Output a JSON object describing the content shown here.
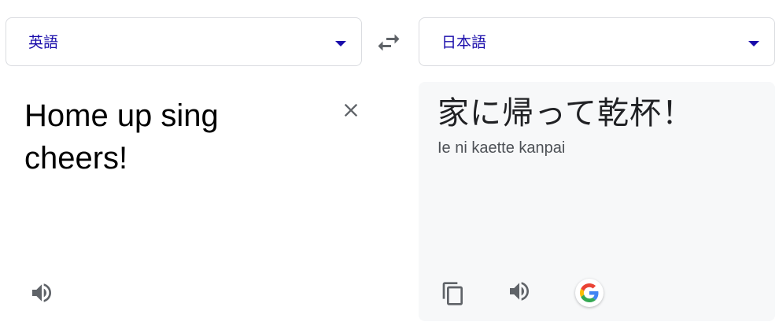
{
  "source_language": {
    "label": "英語"
  },
  "target_language": {
    "label": "日本語"
  },
  "source": {
    "text": "Home up sing cheers!"
  },
  "target": {
    "text": "家に帰って乾杯！",
    "romanization": "Ie ni kaette kanpai"
  },
  "icons": {
    "swap": "swap-arrows-icon",
    "clear": "close-icon",
    "source_speaker": "speaker-icon",
    "copy": "copy-icon",
    "target_speaker": "speaker-icon",
    "google": "google-g-logo-icon"
  },
  "colors": {
    "language_link": "#1a0dab",
    "target_pane_background": "#f7f8f9",
    "icon_gray": "#5f6368"
  }
}
